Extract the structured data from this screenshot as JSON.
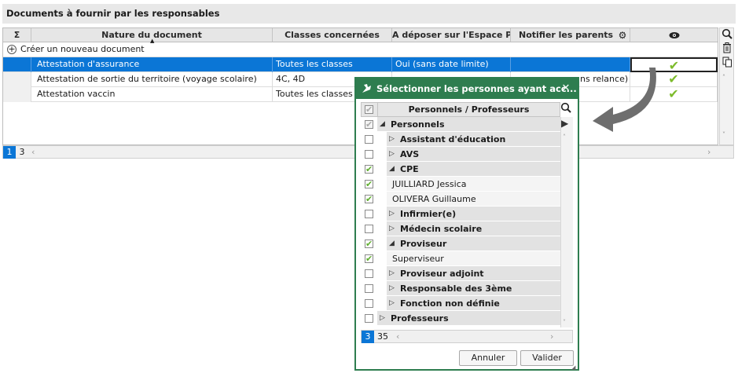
{
  "panel": {
    "title": "Documents à fournir par les responsables"
  },
  "grid": {
    "sigma": "Σ",
    "columns": {
      "nature": "Nature du document",
      "classes": "Classes concernées",
      "deposer": "A déposer sur l'Espace P...",
      "notifier": "Notifier les parents"
    },
    "create_label": "Créer un nouveau document",
    "rows": [
      {
        "nature": "Attestation d'assurance",
        "classes": "Toutes les classes",
        "deposer": "Oui (sans date limite)",
        "notifier": ""
      },
      {
        "nature": "Attestation de sortie du territoire (voyage scolaire)",
        "classes": "4C, 4D",
        "deposer": "",
        "notifier": "ns relance)"
      },
      {
        "nature": "Attestation vaccin",
        "classes": "Toutes les classes",
        "deposer": "",
        "notifier": ""
      }
    ],
    "check_glyph": "✔",
    "pager": {
      "current": "1",
      "total": "3"
    }
  },
  "dialog": {
    "title": "Sélectionner les personnes ayant acc...",
    "close": "✕",
    "column_header": "Personnels / Professeurs",
    "check_glyph": "✔",
    "items": [
      {
        "label": "Personnels",
        "group": true,
        "level": 0,
        "expanded": true,
        "checked": "partial"
      },
      {
        "label": "Assistant d'éducation",
        "group": true,
        "level": 1,
        "expanded": false,
        "checked": "no"
      },
      {
        "label": "AVS",
        "group": true,
        "level": 1,
        "expanded": false,
        "checked": "no"
      },
      {
        "label": "CPE",
        "group": true,
        "level": 1,
        "expanded": true,
        "checked": "yes"
      },
      {
        "label": "JUILLIARD Jessica",
        "group": false,
        "level": 2,
        "checked": "yes"
      },
      {
        "label": "OLIVERA Guillaume",
        "group": false,
        "level": 2,
        "checked": "yes"
      },
      {
        "label": "Infirmier(e)",
        "group": true,
        "level": 1,
        "expanded": false,
        "checked": "no"
      },
      {
        "label": "Médecin scolaire",
        "group": true,
        "level": 1,
        "expanded": false,
        "checked": "no"
      },
      {
        "label": "Proviseur",
        "group": true,
        "level": 1,
        "expanded": true,
        "checked": "yes"
      },
      {
        "label": "Superviseur",
        "group": false,
        "level": 2,
        "checked": "yes"
      },
      {
        "label": "Proviseur adjoint",
        "group": true,
        "level": 1,
        "expanded": false,
        "checked": "no"
      },
      {
        "label": "Responsable des 3ème",
        "group": true,
        "level": 1,
        "expanded": false,
        "checked": "no"
      },
      {
        "label": "Fonction non définie",
        "group": true,
        "level": 1,
        "expanded": false,
        "checked": "no"
      },
      {
        "label": "Professeurs",
        "group": true,
        "level": 0,
        "expanded": false,
        "checked": "no"
      }
    ],
    "pager": {
      "current": "3",
      "total": "35"
    },
    "cancel_label": "Annuler",
    "validate_label": "Valider"
  },
  "colors": {
    "accent": "#0b76d6",
    "dialog": "#2e7d4f",
    "check": "#7dbb2c"
  }
}
